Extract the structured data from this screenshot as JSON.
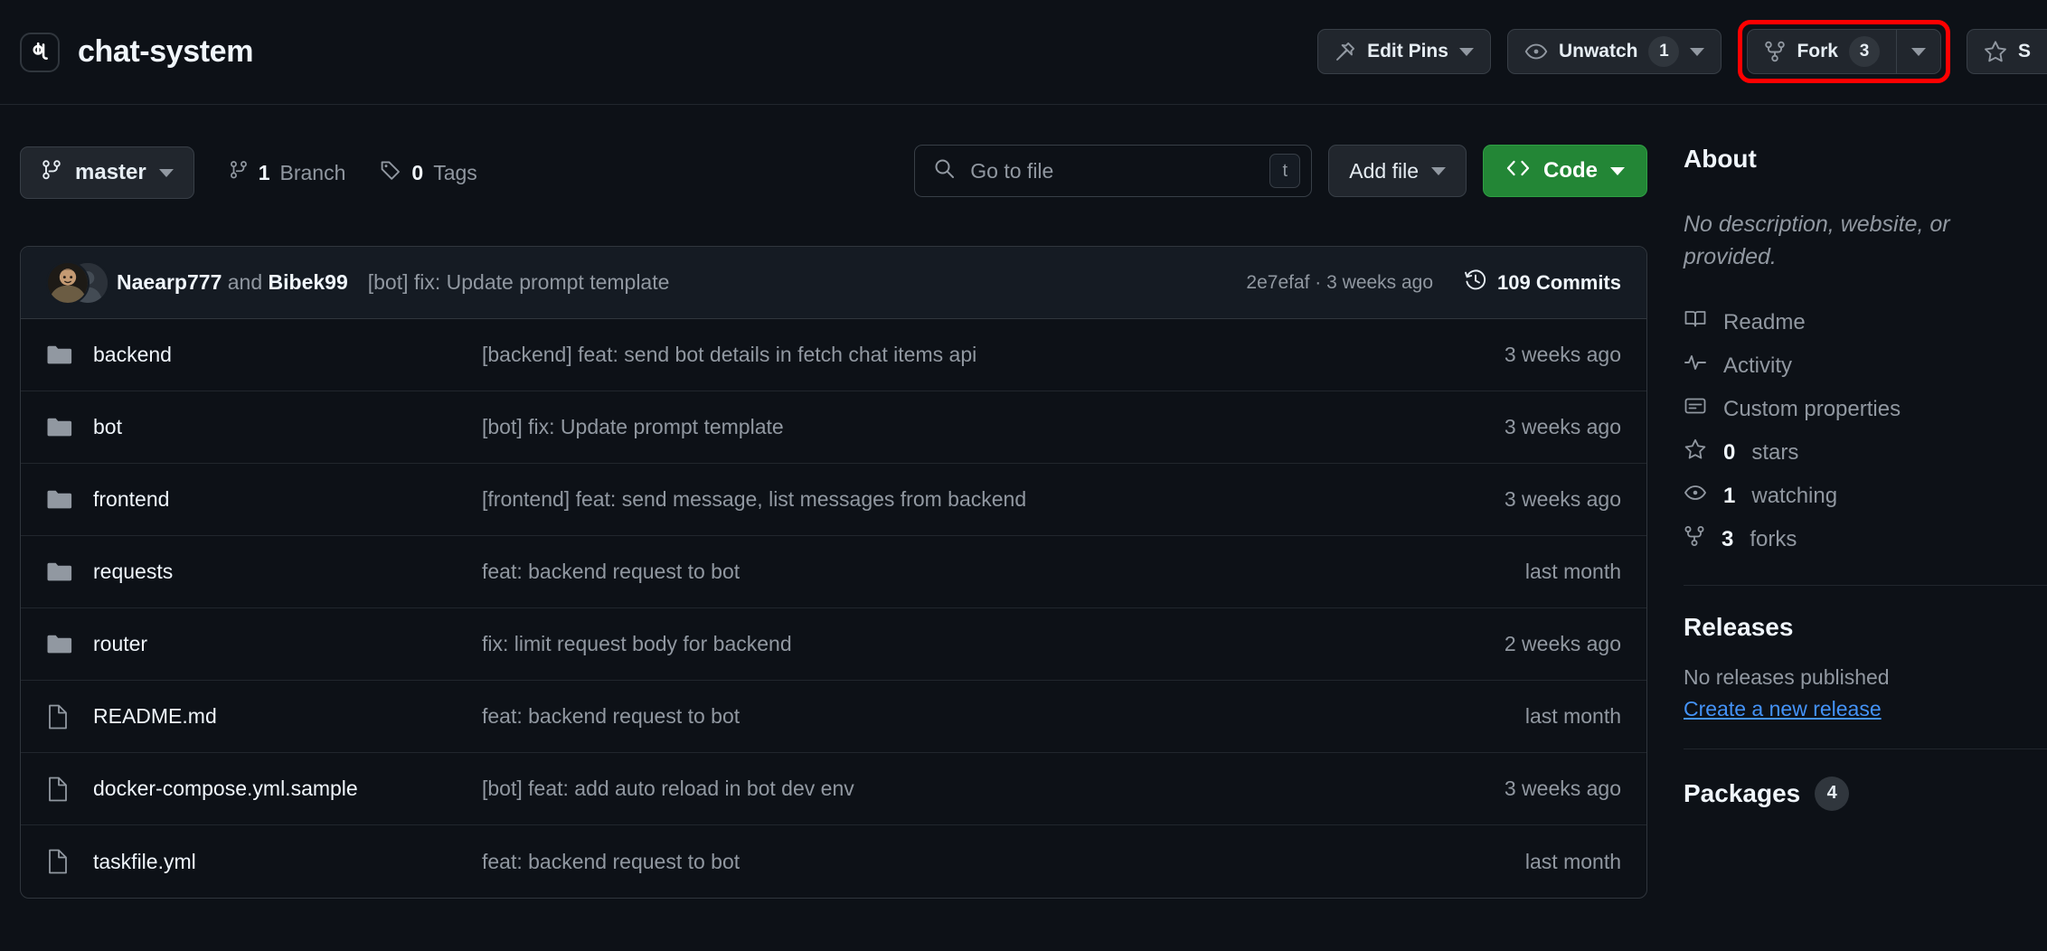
{
  "header": {
    "logo_icon": "repo-logo-icon",
    "repo_name": "chat-system",
    "edit_pins_label": "Edit Pins",
    "unwatch_label": "Unwatch",
    "unwatch_count": "1",
    "fork_label": "Fork",
    "fork_count": "3",
    "star_label": "S"
  },
  "toolbar": {
    "branch_name": "master",
    "branch_count": "1",
    "branch_word": "Branch",
    "tag_count": "0",
    "tag_word": "Tags",
    "search_placeholder": "Go to file",
    "search_value": "",
    "search_kbd": "t",
    "add_file_label": "Add file",
    "code_label": "Code"
  },
  "commit_bar": {
    "author_primary": "Naearp777",
    "author_joiner": "and",
    "author_secondary": "Bibek99",
    "message": "[bot] fix: Update prompt template",
    "hash_and_time": "2e7efaf · 3 weeks ago",
    "commits_label": "109 Commits"
  },
  "files": [
    {
      "icon": "folder-icon",
      "name": "backend",
      "commit": "[backend] feat: send bot details in fetch chat items api",
      "time": "3 weeks ago"
    },
    {
      "icon": "folder-icon",
      "name": "bot",
      "commit": "[bot] fix: Update prompt template",
      "time": "3 weeks ago"
    },
    {
      "icon": "folder-icon",
      "name": "frontend",
      "commit": "[frontend] feat: send message, list messages from backend",
      "time": "3 weeks ago"
    },
    {
      "icon": "folder-icon",
      "name": "requests",
      "commit": "feat: backend request to bot",
      "time": "last month"
    },
    {
      "icon": "folder-icon",
      "name": "router",
      "commit": "fix: limit request body for backend",
      "time": "2 weeks ago"
    },
    {
      "icon": "file-icon",
      "name": "README.md",
      "commit": "feat: backend request to bot",
      "time": "last month"
    },
    {
      "icon": "file-icon",
      "name": "docker-compose.yml.sample",
      "commit": "[bot] feat: add auto reload in bot dev env",
      "time": "3 weeks ago"
    },
    {
      "icon": "file-icon",
      "name": "taskfile.yml",
      "commit": "feat: backend request to bot",
      "time": "last month"
    }
  ],
  "sidebar": {
    "about_title": "About",
    "about_description": "No description, website, or",
    "about_description_line2": "provided.",
    "items": [
      {
        "icon": "book-icon",
        "label": "Readme"
      },
      {
        "icon": "pulse-icon",
        "label": "Activity"
      },
      {
        "icon": "properties-icon",
        "label": "Custom properties"
      },
      {
        "icon": "star-icon",
        "count": "0",
        "label": "stars"
      },
      {
        "icon": "eye-icon",
        "count": "1",
        "label": "watching"
      },
      {
        "icon": "fork-icon",
        "count": "3",
        "label": "forks"
      }
    ],
    "releases_title": "Releases",
    "releases_empty": "No releases published",
    "releases_link": "Create a new release",
    "packages_title": "Packages",
    "packages_count": "4"
  },
  "colors": {
    "accent_green": "#238636",
    "link_blue": "#4493f8",
    "highlight_red": "#ff0000",
    "page_bg": "#0d1117"
  }
}
